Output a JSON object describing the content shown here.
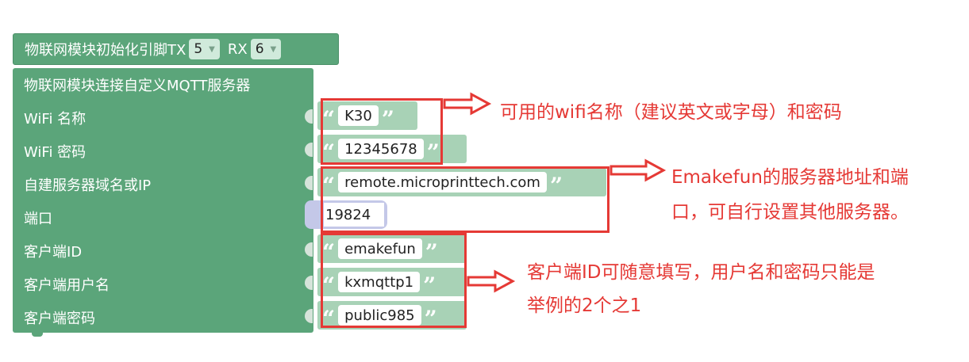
{
  "init_block": {
    "label": "物联网模块初始化引脚TX",
    "tx_value": "5",
    "rx_label": "RX",
    "rx_value": "6"
  },
  "connect_block": {
    "title": "物联网模块连接自定义MQTT服务器",
    "rows": [
      {
        "label": "WiFi 名称",
        "value": "K30"
      },
      {
        "label": "WiFi 密码",
        "value": "12345678"
      },
      {
        "label": "自建服务器域名或IP",
        "value": "remote.microprinttech.com"
      },
      {
        "label": "端口",
        "value": "19824"
      },
      {
        "label": "客户端ID",
        "value": "emakefun"
      },
      {
        "label": "客户端用户名",
        "value": "kxmqttp1"
      },
      {
        "label": "客户端密码",
        "value": "public985"
      }
    ]
  },
  "annotations": {
    "wifi": "可用的wifi名称（建议英文或字母）和密码",
    "server_line1": "Emakefun的服务器地址和端",
    "server_line2": "口，可自行设置其他服务器。",
    "client_line1": "客户端ID可随意填写，用户名和密码只能是",
    "client_line2": "举例的2个之1"
  },
  "colors": {
    "block_green": "#5ba57a",
    "text_block_green": "#a8d2b6",
    "number_block": "#c4c8e8",
    "annotation_red": "#e53935"
  }
}
